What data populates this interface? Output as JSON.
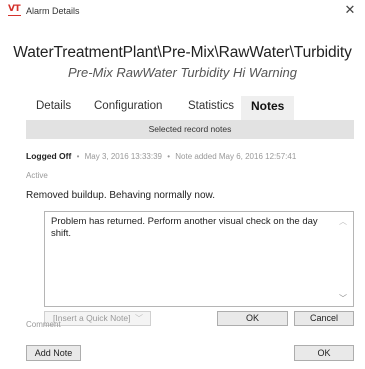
{
  "window": {
    "logo_text": "VT",
    "title": "Alarm Details",
    "close_glyph": "✕"
  },
  "header": {
    "path": "WaterTreatmentPlant\\Pre-Mix\\RawWater\\Turbidity",
    "subtitle": "Pre-Mix RawWater Turbidity Hi Warning"
  },
  "tabs": [
    {
      "label": "Details",
      "active": false
    },
    {
      "label": "Configuration",
      "active": false
    },
    {
      "label": "Statistics",
      "active": false
    },
    {
      "label": "Notes",
      "active": true
    }
  ],
  "notes": {
    "section_title": "Selected record notes",
    "author": "Logged Off",
    "record_time": "May 3, 2016 13:33:39",
    "note_added": "Note added May 6, 2016 12:57:41",
    "separator": "•",
    "status": "Active",
    "note_text": "Removed buildup. Behaving normally now.",
    "edit_text": "Problem has returned. Perform another visual check on the day shift.",
    "quick_note_placeholder": "[Insert a Quick Note]",
    "ok_label": "OK",
    "cancel_label": "Cancel",
    "comment_label": "Comment"
  },
  "footer": {
    "add_note_label": "Add Note",
    "ok_label": "OK"
  },
  "colors": {
    "logo": "#d4322c",
    "section_bar": "#e2e2e2",
    "active_tab": "#efefef"
  }
}
